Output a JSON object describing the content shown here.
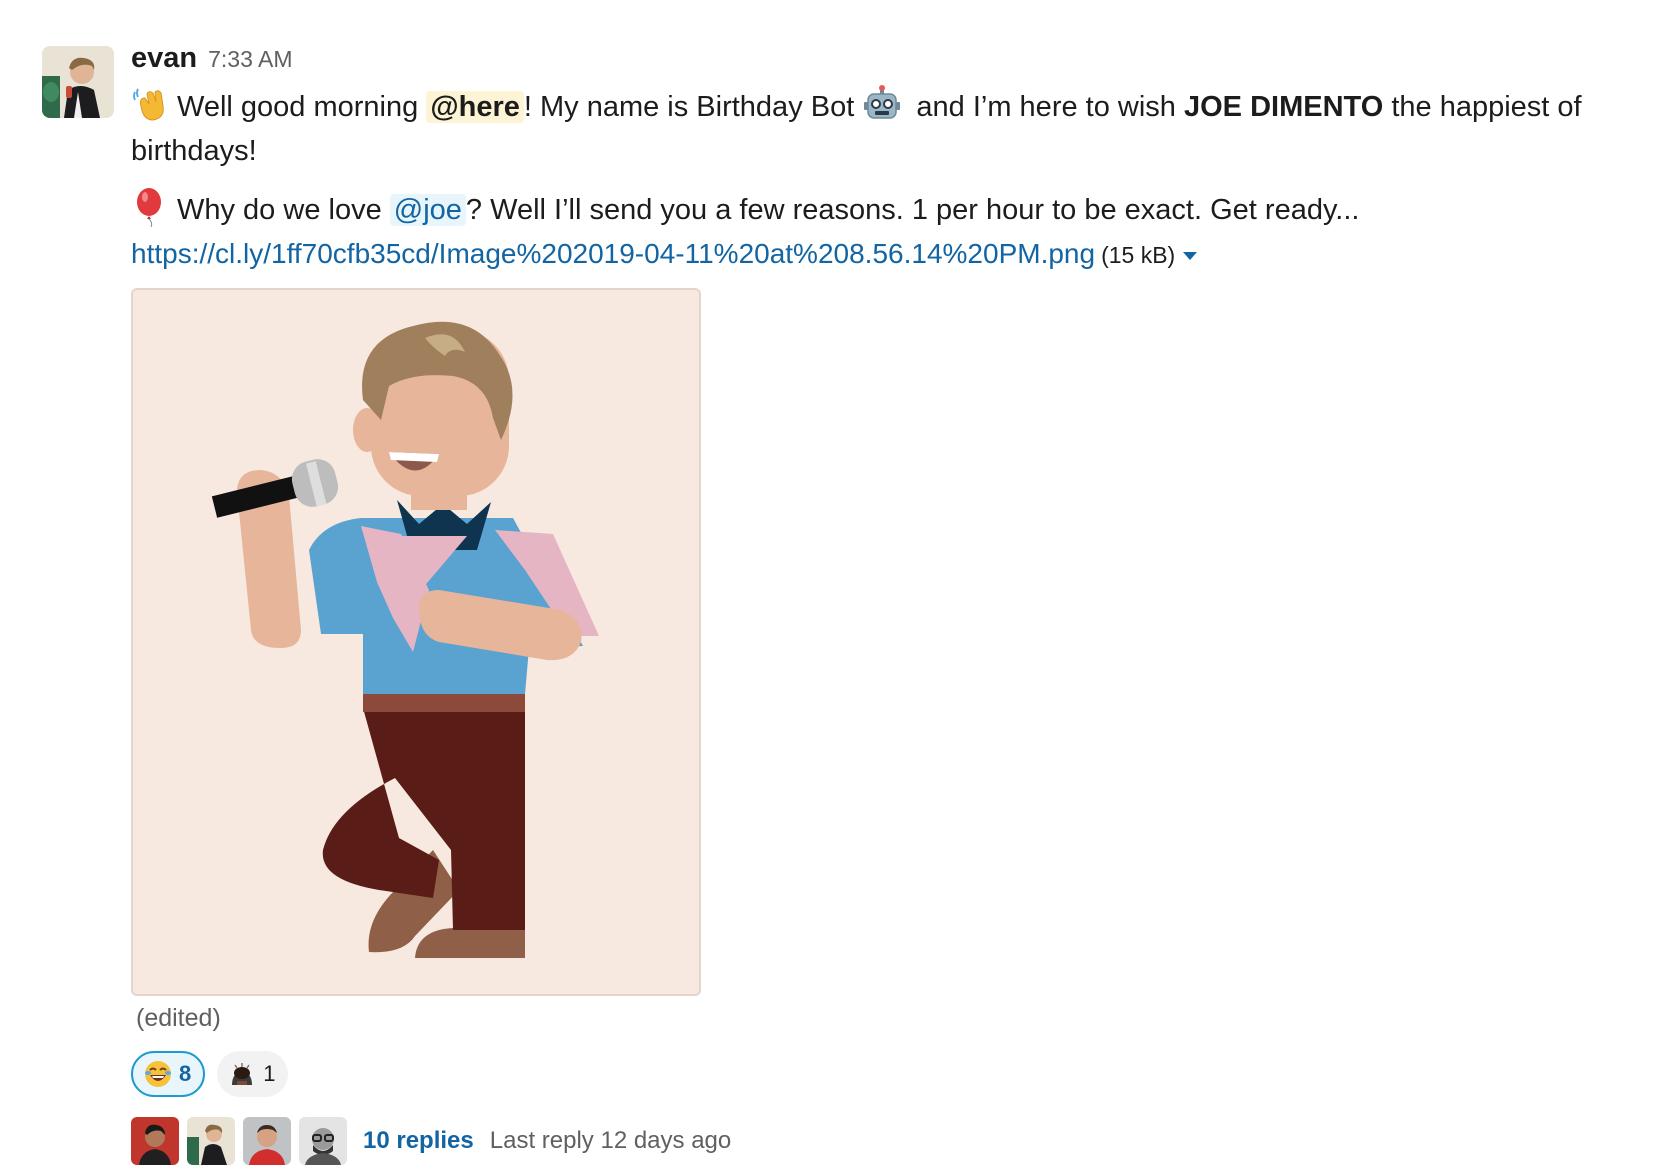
{
  "message": {
    "author": "evan",
    "timestamp": "7:33 AM",
    "line1": {
      "greeting": "Well good morning ",
      "mention": "@here",
      "text1": "! My name is Birthday Bot ",
      "text2": " and I’m here to wish ",
      "bold_name": "JOE DIMENTO",
      "text3": " the happiest of birthdays!"
    },
    "line2": {
      "text1": "Why do we love ",
      "mention": "@joe",
      "text2": "? Well I’ll send you a few reasons. 1 per hour to be exact. Get ready..."
    },
    "attachment": {
      "url": "https://cl.ly/1ff70cfb35cd/Image%202019-04-11%20at%208.56.14%20PM.png",
      "size": "(15 kB)"
    },
    "edited_label": "(edited)"
  },
  "reactions": [
    {
      "emoji": "joy-emoji",
      "count": "8",
      "active": true
    },
    {
      "emoji": "bowing-emoji",
      "count": "1",
      "active": false
    }
  ],
  "thread": {
    "replies_label": "10 replies",
    "last_reply": "Last reply 12 days ago"
  },
  "colors": {
    "link": "#1264a3",
    "mention_here_bg": "#fcf4d5",
    "mention_user_bg": "#e8f5fa",
    "image_bg": "#f7e8e0"
  }
}
